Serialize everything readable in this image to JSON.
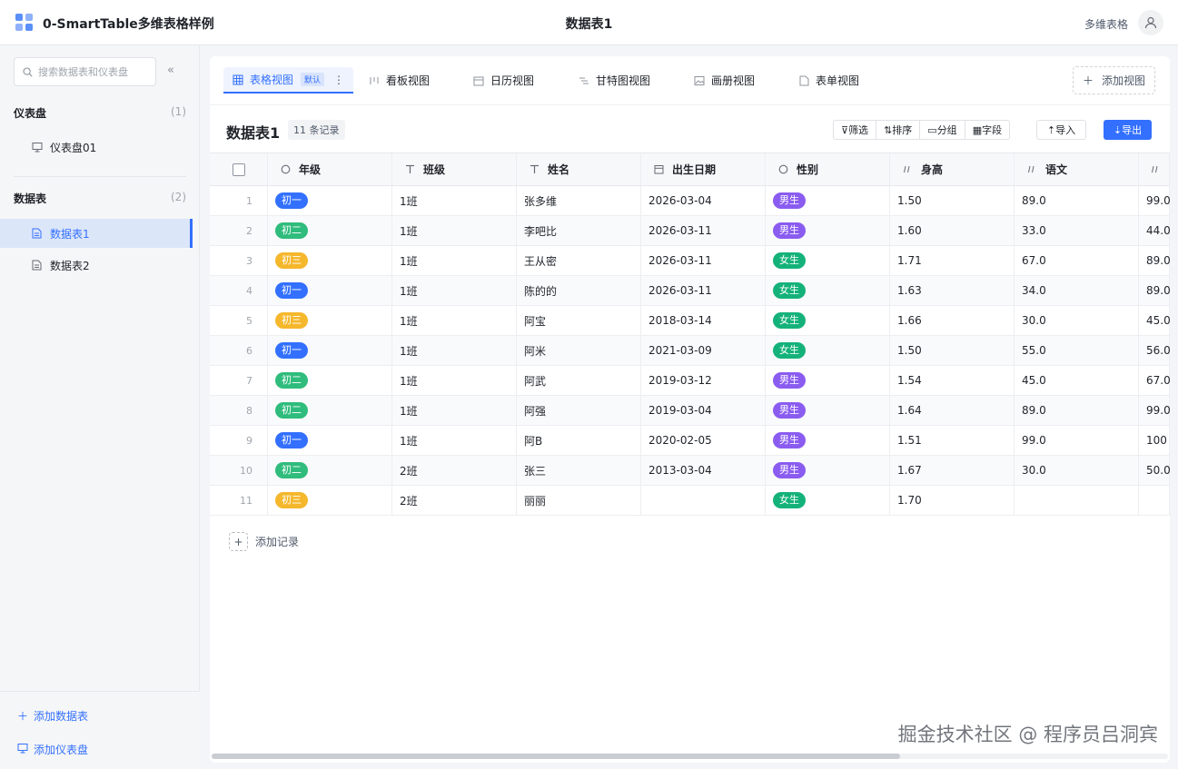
{
  "header": {
    "app_title": "0-SmartTable多维表格样例",
    "page_title": "数据表1",
    "mode_label": "多维表格"
  },
  "sidebar": {
    "search_placeholder": "搜索数据表和仪表盘",
    "dashboards": {
      "title": "仪表盘",
      "count": "(1)",
      "items": [
        {
          "label": "仪表盘01"
        }
      ]
    },
    "tables": {
      "title": "数据表",
      "count": "(2)",
      "items": [
        {
          "label": "数据表1",
          "active": true
        },
        {
          "label": "数据表2",
          "active": false
        }
      ]
    },
    "add_table": "添加数据表",
    "add_dashboard": "添加仪表盘"
  },
  "views": {
    "tabs": [
      {
        "label": "表格视图",
        "icon": "grid-icon",
        "badge": "默认",
        "active": true
      },
      {
        "label": "看板视图",
        "icon": "kanban-icon"
      },
      {
        "label": "日历视图",
        "icon": "calendar-icon"
      },
      {
        "label": "甘特图视图",
        "icon": "gantt-icon"
      },
      {
        "label": "画册视图",
        "icon": "gallery-icon"
      },
      {
        "label": "表单视图",
        "icon": "form-icon"
      }
    ],
    "add_view": "添加视图"
  },
  "table": {
    "title": "数据表1",
    "record_count": "11 条记录",
    "toolbar": {
      "filter": "筛选",
      "sort": "排序",
      "group": "分组",
      "fields": "字段",
      "import": "导入",
      "export": "导出"
    },
    "columns": [
      {
        "label": "年级",
        "icon": "circle-icon"
      },
      {
        "label": "班级",
        "icon": "text-icon"
      },
      {
        "label": "姓名",
        "icon": "text-icon"
      },
      {
        "label": "出生日期",
        "icon": "calendar-icon"
      },
      {
        "label": "性别",
        "icon": "circle-icon"
      },
      {
        "label": "身高",
        "icon": "number-icon"
      },
      {
        "label": "语文",
        "icon": "number-icon"
      },
      {
        "label": "",
        "icon": "number-icon"
      }
    ],
    "rows": [
      {
        "idx": "1",
        "grade": "初一",
        "cls": "1班",
        "name": "张多维",
        "dob": "2026-03-04",
        "gender": "男生",
        "height": "1.50",
        "chinese": "89.0",
        "next": "99.0"
      },
      {
        "idx": "2",
        "grade": "初二",
        "cls": "1班",
        "name": "李吧比",
        "dob": "2026-03-11",
        "gender": "男生",
        "height": "1.60",
        "chinese": "33.0",
        "next": "44.0"
      },
      {
        "idx": "3",
        "grade": "初三",
        "cls": "1班",
        "name": "王从密",
        "dob": "2026-03-11",
        "gender": "女生",
        "height": "1.71",
        "chinese": "67.0",
        "next": "89.0"
      },
      {
        "idx": "4",
        "grade": "初一",
        "cls": "1班",
        "name": "陈的的",
        "dob": "2026-03-11",
        "gender": "女生",
        "height": "1.63",
        "chinese": "34.0",
        "next": "89.0"
      },
      {
        "idx": "5",
        "grade": "初三",
        "cls": "1班",
        "name": "阿宝",
        "dob": "2018-03-14",
        "gender": "女生",
        "height": "1.66",
        "chinese": "30.0",
        "next": "45.0"
      },
      {
        "idx": "6",
        "grade": "初一",
        "cls": "1班",
        "name": "阿米",
        "dob": "2021-03-09",
        "gender": "女生",
        "height": "1.50",
        "chinese": "55.0",
        "next": "56.0"
      },
      {
        "idx": "7",
        "grade": "初二",
        "cls": "1班",
        "name": "阿武",
        "dob": "2019-03-12",
        "gender": "男生",
        "height": "1.54",
        "chinese": "45.0",
        "next": "67.0"
      },
      {
        "idx": "8",
        "grade": "初二",
        "cls": "1班",
        "name": "阿强",
        "dob": "2019-03-04",
        "gender": "男生",
        "height": "1.64",
        "chinese": "89.0",
        "next": "99.0"
      },
      {
        "idx": "9",
        "grade": "初一",
        "cls": "1班",
        "name": "阿B",
        "dob": "2020-02-05",
        "gender": "男生",
        "height": "1.51",
        "chinese": "99.0",
        "next": "100"
      },
      {
        "idx": "10",
        "grade": "初二",
        "cls": "2班",
        "name": "张三",
        "dob": "2013-03-04",
        "gender": "男生",
        "height": "1.67",
        "chinese": "30.0",
        "next": "50.0"
      },
      {
        "idx": "11",
        "grade": "初三",
        "cls": "2班",
        "name": "丽丽",
        "dob": "",
        "gender": "女生",
        "height": "1.70",
        "chinese": "",
        "next": ""
      }
    ],
    "add_record": "添加记录"
  },
  "colors": {
    "accent": "#3370ff",
    "grade": {
      "初一": "#3370ff",
      "初二": "#2fbc7c",
      "初三": "#f5b72c"
    },
    "gender": {
      "男生": "#8a5cf0",
      "女生": "#14b27a"
    }
  },
  "watermark": "掘金技术社区 @ 程序员吕洞宾"
}
